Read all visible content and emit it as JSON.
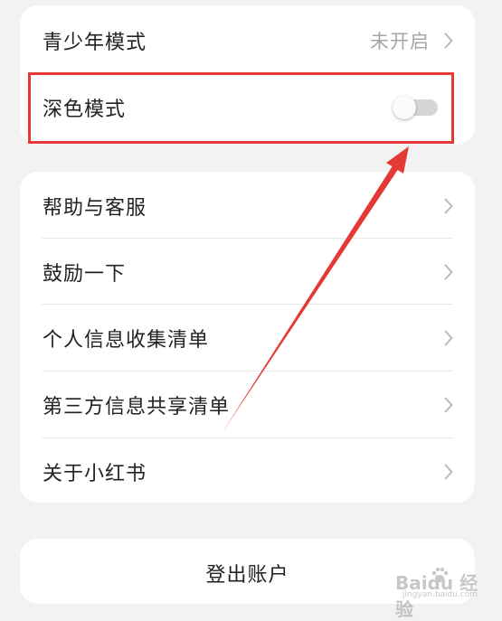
{
  "settings_group_1": {
    "items": [
      {
        "label": "青少年模式",
        "value": "未开启"
      },
      {
        "label": "深色模式",
        "toggle_on": false
      }
    ]
  },
  "settings_group_2": {
    "items": [
      {
        "label": "帮助与客服"
      },
      {
        "label": "鼓励一下"
      },
      {
        "label": "个人信息收集清单"
      },
      {
        "label": "第三方信息共享清单"
      },
      {
        "label": "关于小红书"
      }
    ]
  },
  "logout": {
    "label": "登出账户"
  },
  "annotation": {
    "highlight_color": "#e53935"
  },
  "watermark": {
    "brand": "Baidu 经验",
    "url": "jingyan.baidu.com"
  },
  "colors": {
    "background": "#f2f2f2",
    "card": "#ffffff",
    "text": "#222222",
    "muted": "#a6a6a6"
  },
  "icons": {
    "chevron": "chevron-right-icon",
    "paw": "paw-icon"
  }
}
